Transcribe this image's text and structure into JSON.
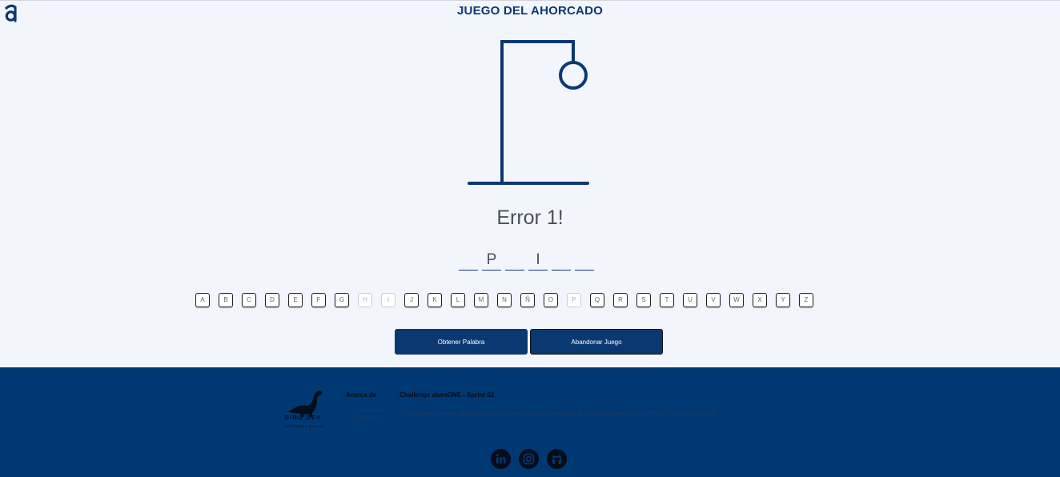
{
  "app": {
    "title": "JUEGO DEL AHORCADO"
  },
  "game": {
    "message": "Error 1!",
    "word_slots": [
      "",
      "P",
      "",
      "I",
      "",
      ""
    ]
  },
  "keyboard": [
    {
      "letter": "A",
      "used": false
    },
    {
      "letter": "B",
      "used": false
    },
    {
      "letter": "C",
      "used": false
    },
    {
      "letter": "D",
      "used": false
    },
    {
      "letter": "E",
      "used": false
    },
    {
      "letter": "F",
      "used": false
    },
    {
      "letter": "G",
      "used": false
    },
    {
      "letter": "H",
      "used": true
    },
    {
      "letter": "I",
      "used": true
    },
    {
      "letter": "J",
      "used": false
    },
    {
      "letter": "K",
      "used": false
    },
    {
      "letter": "L",
      "used": false
    },
    {
      "letter": "M",
      "used": false
    },
    {
      "letter": "N",
      "used": false
    },
    {
      "letter": "Ñ",
      "used": false
    },
    {
      "letter": "O",
      "used": false
    },
    {
      "letter": "P",
      "used": true
    },
    {
      "letter": "Q",
      "used": false
    },
    {
      "letter": "R",
      "used": false
    },
    {
      "letter": "S",
      "used": false
    },
    {
      "letter": "T",
      "used": false
    },
    {
      "letter": "U",
      "used": false
    },
    {
      "letter": "V",
      "used": false
    },
    {
      "letter": "W",
      "used": false
    },
    {
      "letter": "X",
      "used": false
    },
    {
      "letter": "Y",
      "used": false
    },
    {
      "letter": "Z",
      "used": false
    }
  ],
  "actions": {
    "new_word": "Obtener Palabra",
    "quit": "Abandonar Juego"
  },
  "footer": {
    "brand_name": "DINO DEV.",
    "brand_tagline": "SISTEMAS A MEDIDA",
    "about_heading": "Acerca de",
    "about_links": [
      "Empresa",
      "Equipo"
    ],
    "challenge_title": "Challenge aluraONE - Sprint 02",
    "challenge_desc": "Proyecto del juego de ahorcado para poner en practica lo aprendido a lo largo de la formación en HTML5, CSS3 y JavaScript."
  },
  "social": [
    "linkedin-icon",
    "instagram-icon",
    "github-icon"
  ],
  "colors": {
    "primary": "#0a3871",
    "background": "#f3f5fc",
    "footer": "#003874"
  }
}
